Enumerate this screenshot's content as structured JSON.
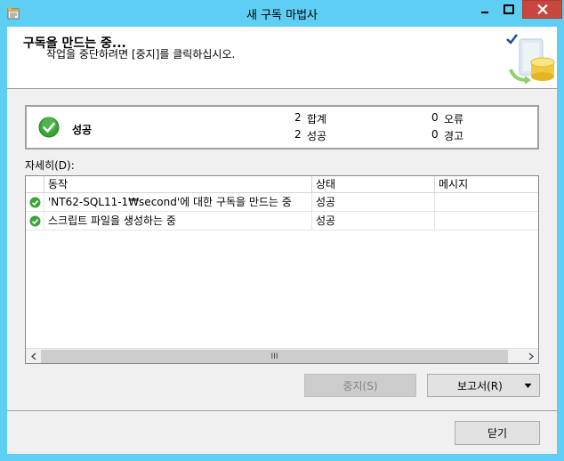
{
  "window": {
    "title": "새 구독 마법사",
    "icons": {
      "app": "wizard-app-icon",
      "minimize": "minimize-icon",
      "maximize": "maximize-icon",
      "close": "close-icon"
    }
  },
  "header": {
    "title": "구독을 만드는 중...",
    "subtitle": "작업을 중단하려면 [중지]를 클릭하십시오.",
    "graphic": "database-wizard-graphic"
  },
  "summary": {
    "status": "성공",
    "status_icon": "success-icon",
    "total_count": "2",
    "total_label": "합계",
    "success_count": "2",
    "success_label": "성공",
    "error_count": "0",
    "error_label": "오류",
    "warning_count": "0",
    "warning_label": "경고"
  },
  "details": {
    "label": "자세히(D):",
    "columns": [
      "동작",
      "상태",
      "메시지"
    ],
    "rows": [
      {
        "action": "'NT62-SQL11-1₩second'에 대한 구독을 만드는 중",
        "status": "성공",
        "message": ""
      },
      {
        "action": "스크립트 파일을 생성하는 중",
        "status": "성공",
        "message": ""
      }
    ],
    "scroll_thumb_label": "III"
  },
  "buttons": {
    "stop": "중지(S)",
    "report": "보고서(R)",
    "close": "닫기"
  },
  "colors": {
    "title_bar": "#5fcef3",
    "close_button": "#c7473e",
    "success_green": "#3aa537",
    "dialog_bg": "#f0f0f0"
  }
}
